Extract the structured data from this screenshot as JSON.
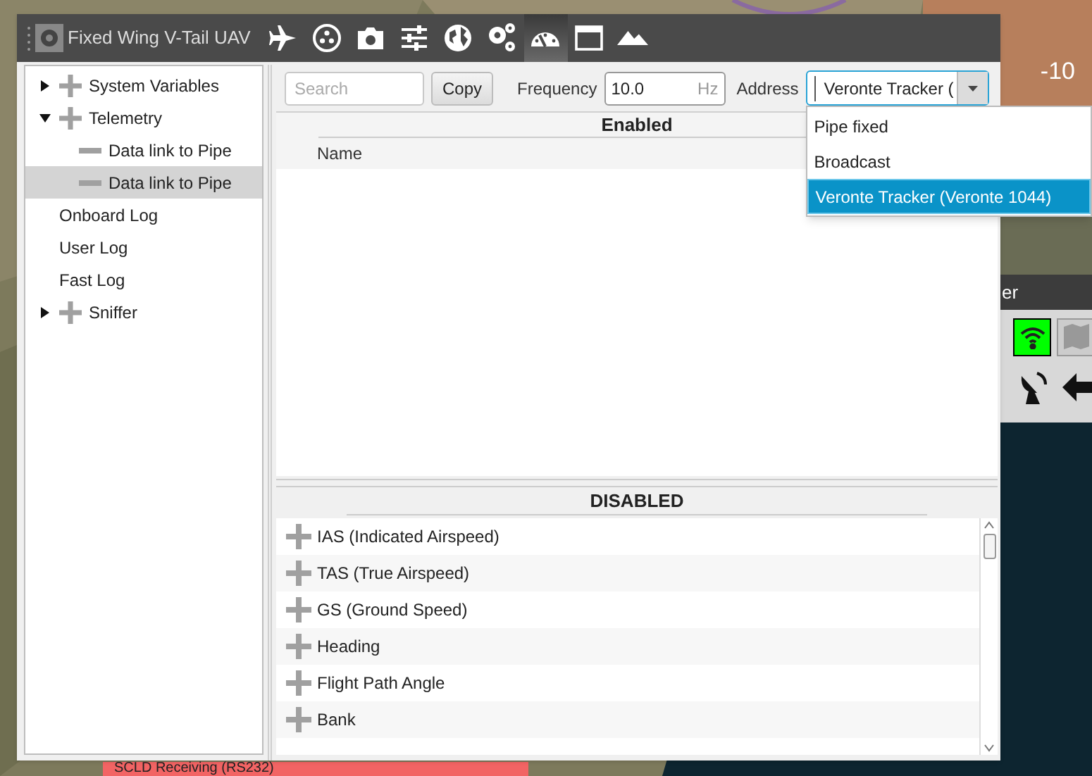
{
  "window": {
    "title": "Fixed Wing V-Tail UAV",
    "toolbar": [
      {
        "kind": "plane",
        "selected": false
      },
      {
        "kind": "dots",
        "selected": false
      },
      {
        "kind": "camera",
        "selected": false
      },
      {
        "kind": "sliders",
        "selected": false
      },
      {
        "kind": "globe",
        "selected": false
      },
      {
        "kind": "gears",
        "selected": false
      },
      {
        "kind": "gauge",
        "selected": true
      },
      {
        "kind": "window",
        "selected": false
      },
      {
        "kind": "mountain",
        "selected": false
      }
    ]
  },
  "tree": [
    {
      "label": "System Variables",
      "kind": "folder",
      "expanded": false,
      "selected": false
    },
    {
      "label": "Telemetry",
      "kind": "folder",
      "expanded": true,
      "selected": false,
      "children": [
        {
          "label": "Data link to Pipe",
          "kind": "link",
          "selected": false
        },
        {
          "label": "Data link to Pipe",
          "kind": "link",
          "selected": true
        }
      ]
    },
    {
      "label": "Onboard Log",
      "kind": "leaf",
      "selected": false
    },
    {
      "label": "User Log",
      "kind": "leaf",
      "selected": false
    },
    {
      "label": "Fast Log",
      "kind": "leaf",
      "selected": false
    },
    {
      "label": "Sniffer",
      "kind": "folder",
      "expanded": false,
      "selected": false
    }
  ],
  "controls": {
    "search": {
      "placeholder": "Search"
    },
    "copy": "Copy",
    "frequency_label": "Frequency",
    "frequency": "10.0",
    "frequency_unit": "Hz",
    "address_label": "Address",
    "address": "Veronte Tracker (",
    "address_options": [
      {
        "label": "Pipe fixed",
        "selected": false
      },
      {
        "label": "Broadcast",
        "selected": false
      },
      {
        "label": "Veronte Tracker (Veronte 1044)",
        "selected": true
      }
    ]
  },
  "enabled": {
    "title": "Enabled",
    "columns": [
      "Name"
    ]
  },
  "disabled": {
    "title": "DISABLED",
    "rows": [
      "IAS (Indicated Airspeed)",
      "TAS (True Airspeed)",
      "GS (Ground Speed)",
      "Heading",
      "Flight Path Angle",
      "Bank"
    ]
  },
  "side_panel": {
    "reading": "-10"
  },
  "side_window": {
    "title": "er",
    "signal_on": true
  },
  "status_bar": {
    "text": "SCLD Receiving (RS232)"
  }
}
